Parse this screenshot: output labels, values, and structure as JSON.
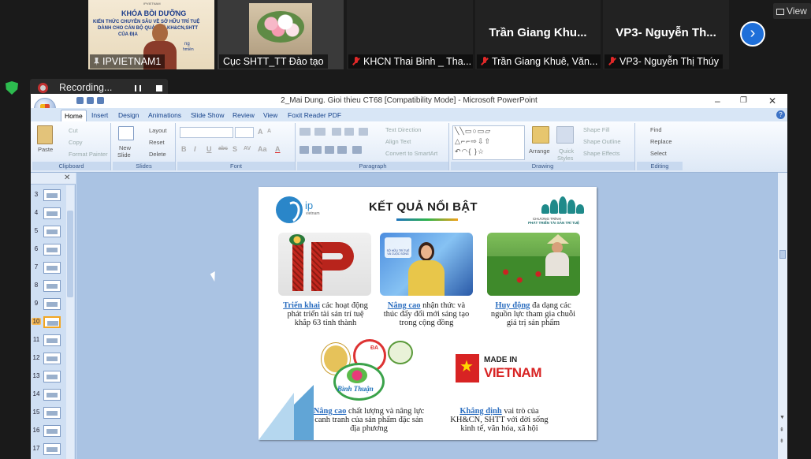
{
  "participants": [
    {
      "name": "IPVIETNAM1",
      "type": "video",
      "icon": "pin-icon"
    },
    {
      "name": "Cục SHTT_TT Đào tạo",
      "type": "video"
    },
    {
      "name": "KHCN Thai Binh _ Tha...",
      "type": "avatar",
      "big": "",
      "icon": "mic-muted-icon"
    },
    {
      "name": "Trần Giang Khuê, Văn...",
      "type": "avatar",
      "big": "Trần Giang Khu...",
      "icon": "mic-muted-icon"
    },
    {
      "name": "VP3- Nguyễn Thị Thúy",
      "type": "avatar",
      "big": "VP3- Nguyễn Th...",
      "icon": "mic-muted-icon"
    }
  ],
  "participant0_slide_text": {
    "brand": "IPVIETNAM",
    "heading": "KHÓA BỒI DƯỠNG",
    "line1": "KIẾN THỨC CHUYÊN SÂU VỀ SỞ HỮU TRÍ TUỆ",
    "line2": "DÀNH CHO CÁN BỘ QUẢN LÝ KH&CN,SHTT",
    "line3": "CỦA ĐỊA",
    "line4": "ng",
    "tag": "hmiền"
  },
  "view_label": "View",
  "recording": {
    "label": "Recording..."
  },
  "window": {
    "title": "2_Mai Dung. Gioi thieu CT68 [Compatibility Mode] - Microsoft PowerPoint",
    "minimize": "–",
    "restore": "❐",
    "close": "✕"
  },
  "tabs": [
    "Home",
    "Insert",
    "Design",
    "Animations",
    "Slide Show",
    "Review",
    "View",
    "Foxit Reader PDF"
  ],
  "help": "?",
  "ribbon": {
    "clipboard": {
      "label": "Clipboard",
      "paste": "Paste",
      "cut": "Cut",
      "copy": "Copy",
      "format_painter": "Format Painter"
    },
    "slides": {
      "label": "Slides",
      "new_slide_1": "New",
      "new_slide_2": "Slide",
      "layout": "Layout",
      "reset": "Reset",
      "delete": "Delete"
    },
    "font": {
      "label": "Font",
      "bold": "B",
      "italic": "I",
      "underline": "U",
      "strike": "abc",
      "shadow": "S",
      "spacing": "AV",
      "case": "Aa",
      "color": "A",
      "grow": "A",
      "shrink": "A"
    },
    "paragraph": {
      "label": "Paragraph",
      "text_direction": "Text Direction",
      "align_text": "Align Text",
      "smartart": "Convert to SmartArt"
    },
    "drawing": {
      "label": "Drawing",
      "arrange": "Arrange",
      "quick_styles_1": "Quick",
      "quick_styles_2": "Styles",
      "shape_fill": "Shape Fill",
      "shape_outline": "Shape Outline",
      "shape_effects": "Shape Effects"
    },
    "editing": {
      "label": "Editing",
      "find": "Find",
      "replace": "Replace",
      "select": "Select"
    }
  },
  "slide_numbers": [
    "3",
    "4",
    "5",
    "6",
    "7",
    "8",
    "9",
    "10",
    "11",
    "12",
    "13",
    "14",
    "15",
    "16",
    "17"
  ],
  "selected_slide": "10",
  "slide": {
    "title": "KẾT QUẢ NỔI BẬT",
    "logo_ip": "ip",
    "logo_ip_sub": "vietnam",
    "logo_right_1": "CHƯƠNG TRÌNH",
    "logo_right_2": "PHÁT TRIỂN TÀI SẢN TRÍ TUỆ",
    "tv_badge_1": "SỞ HỮU TRÍ TUỆ",
    "tv_badge_2": "VÀ CUỘC SỐNG",
    "items": [
      {
        "lead": "Triển khai",
        "rest": " các hoạt động phát triển tài sản trí tuệ khắp 63 tỉnh thành"
      },
      {
        "lead": "Nâng cao",
        "rest": " nhận thức và thúc đẩy đổi mới sáng tạo trong cộng đồng"
      },
      {
        "lead": "Huy động",
        "rest": " đa dạng các nguồn lực tham gia chuỗi giá trị sản phẩm"
      },
      {
        "lead": "Nâng cao",
        "rest": "  chất lượng và nâng lực canh tranh của sản phẩm đặc sản địa phương"
      },
      {
        "lead": "Khẳng định",
        "rest": " vai trò của KH&CN, SHTT với đời sống kinh tế, văn hóa, xã hội"
      }
    ],
    "badge_text": "Bình Thuận",
    "badge_da": "ĐA",
    "made_in": "MADE IN",
    "vietnam": "VIETNAM"
  },
  "colors": {
    "accent_blue": "#1e6fd9",
    "record_red": "#c03030",
    "shield_green": "#2dbb4f"
  }
}
